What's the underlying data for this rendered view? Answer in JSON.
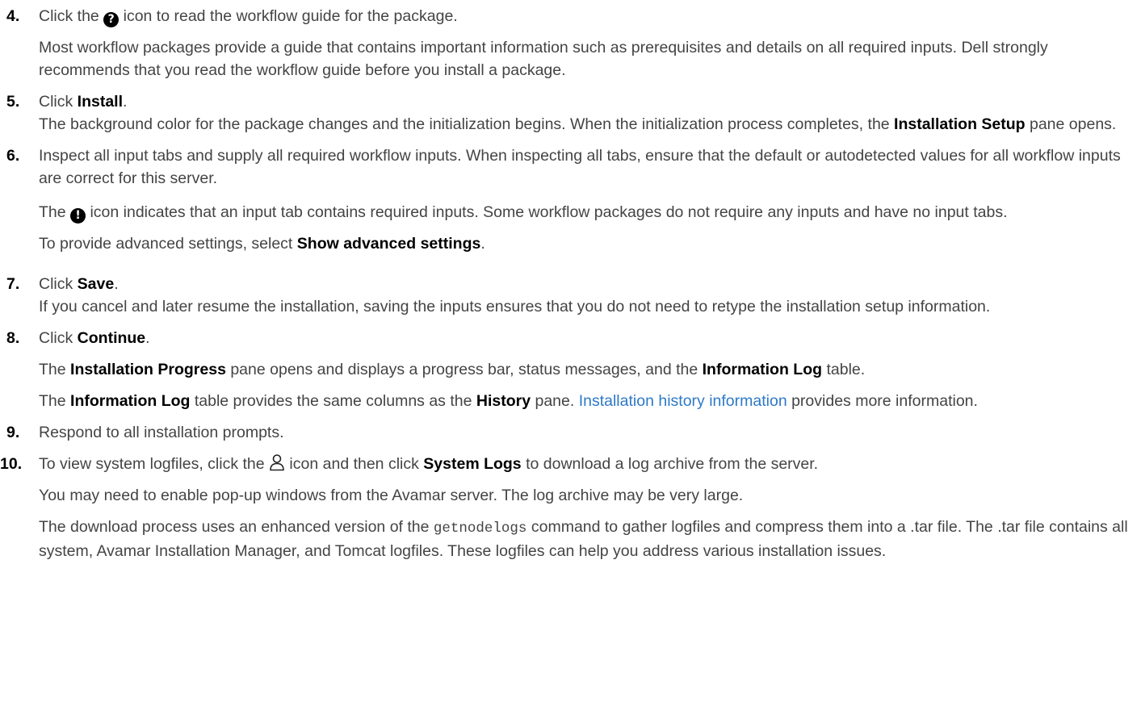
{
  "steps": [
    {
      "num": "4.",
      "line_a": "Click the ",
      "icon": "question-icon",
      "line_b": " icon to read the workflow guide for the package.",
      "para1": "Most workflow packages provide a guide that contains important information such as prerequisites and details on all required inputs. Dell strongly recommends that you read the workflow guide before you install a package."
    },
    {
      "num": "5.",
      "click": "Click ",
      "bold": "Install",
      "dot": ".",
      "para_a": "The background color for the package changes and the initialization begins. When the initialization process completes, the ",
      "para_bold": "Installation Setup",
      "para_b": " pane opens."
    },
    {
      "num": "6.",
      "line": "Inspect all input tabs and supply all required workflow inputs. When inspecting all tabs, ensure that the default or autodetected values for all workflow inputs are correct for this server.",
      "para1_a": "The ",
      "icon": "exclamation-icon",
      "para1_b": " icon indicates that an input tab contains required inputs. Some workflow packages do not require any inputs and have no input tabs.",
      "para2_a": "To provide advanced settings, select ",
      "para2_bold": "Show advanced settings",
      "para2_b": "."
    },
    {
      "num": "7.",
      "click": "Click ",
      "bold": "Save",
      "dot": ".",
      "para": "If you cancel and later resume the installation, saving the inputs ensures that you do not need to retype the installation setup information."
    },
    {
      "num": "8.",
      "click": "Click ",
      "bold": "Continue",
      "dot": ".",
      "para1_a": "The ",
      "para1_bold1": "Installation Progress",
      "para1_b": " pane opens and displays a progress bar, status messages, and the ",
      "para1_bold2": "Information Log",
      "para1_c": " table.",
      "para2_a": "The ",
      "para2_bold1": "Information Log",
      "para2_b": " table provides the same columns as the ",
      "para2_bold2": "History",
      "para2_c": " pane. ",
      "para2_link": "Installation history information",
      "para2_d": " provides more information."
    },
    {
      "num": "9.",
      "line": "Respond to all installation prompts."
    },
    {
      "num": "10.",
      "line_a": "To view system logfiles, click the ",
      "icon": "user-icon",
      "line_b": " icon and then click ",
      "line_bold": "System Logs",
      "line_c": " to download a log archive from the server.",
      "para1": "You may need to enable pop-up windows from the Avamar server. The log archive may be very large.",
      "para2_a": "The download process uses an enhanced version of the ",
      "para2_code": "getnodelogs",
      "para2_b": " command to gather logfiles and compress them into a .tar file. The .tar file contains all system, Avamar Installation Manager, and Tomcat logfiles. These logfiles can help you address various installation issues."
    }
  ]
}
